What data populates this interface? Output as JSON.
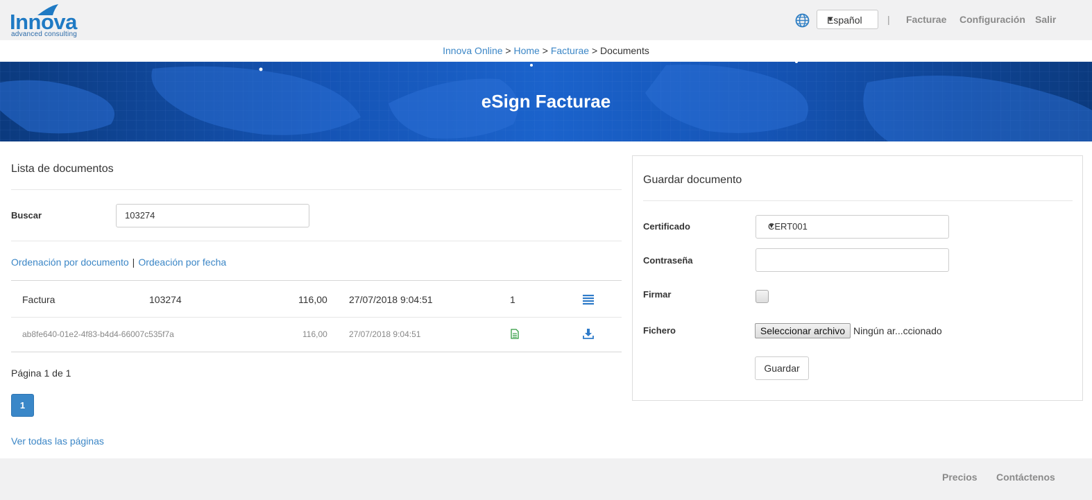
{
  "header": {
    "logo_text": "Innova",
    "logo_subtext": "advanced consulting",
    "language": "Español",
    "nav": [
      "Facturae",
      "Configuración",
      "Salir"
    ]
  },
  "breadcrumb": {
    "items": [
      "Innova Online",
      "Home",
      "Facturae"
    ],
    "current": "Documents",
    "separator": ">"
  },
  "banner": {
    "title": "eSign Facturae"
  },
  "documents": {
    "title": "Lista de documentos",
    "search_label": "Buscar",
    "search_value": "103274",
    "sort_by_document": "Ordenación por documento",
    "sort_by_date": "Ordeación por fecha",
    "sort_separator": "|",
    "rows": [
      {
        "type": "Factura",
        "number": "103274",
        "amount": "116,00",
        "date": "27/07/2018 9:04:51",
        "count": "1",
        "action_icon": "list-icon"
      },
      {
        "id": "ab8fe640-01e2-4f83-b4d4-66007c535f7a",
        "amount": "116,00",
        "date": "27/07/2018 9:04:51",
        "file_icon": "document-icon",
        "action_icon": "download-icon"
      }
    ],
    "page_info": "Página 1 de 1",
    "current_page": "1",
    "all_pages_link": "Ver todas las páginas"
  },
  "save_form": {
    "title": "Guardar documento",
    "certificate_label": "Certificado",
    "certificate_value": "CERT001",
    "password_label": "Contraseña",
    "password_value": "",
    "sign_label": "Firmar",
    "sign_checked": false,
    "file_label": "Fichero",
    "file_button": "Seleccionar archivo",
    "file_status": "Ningún ar...ccionado",
    "save_button": "Guardar"
  },
  "footer": {
    "links": [
      "Precios",
      "Contáctenos"
    ]
  },
  "colors": {
    "link": "#3b86c6",
    "accent": "#3a87c8",
    "banner": "#1554b5",
    "logo": "#1f7ac4"
  }
}
